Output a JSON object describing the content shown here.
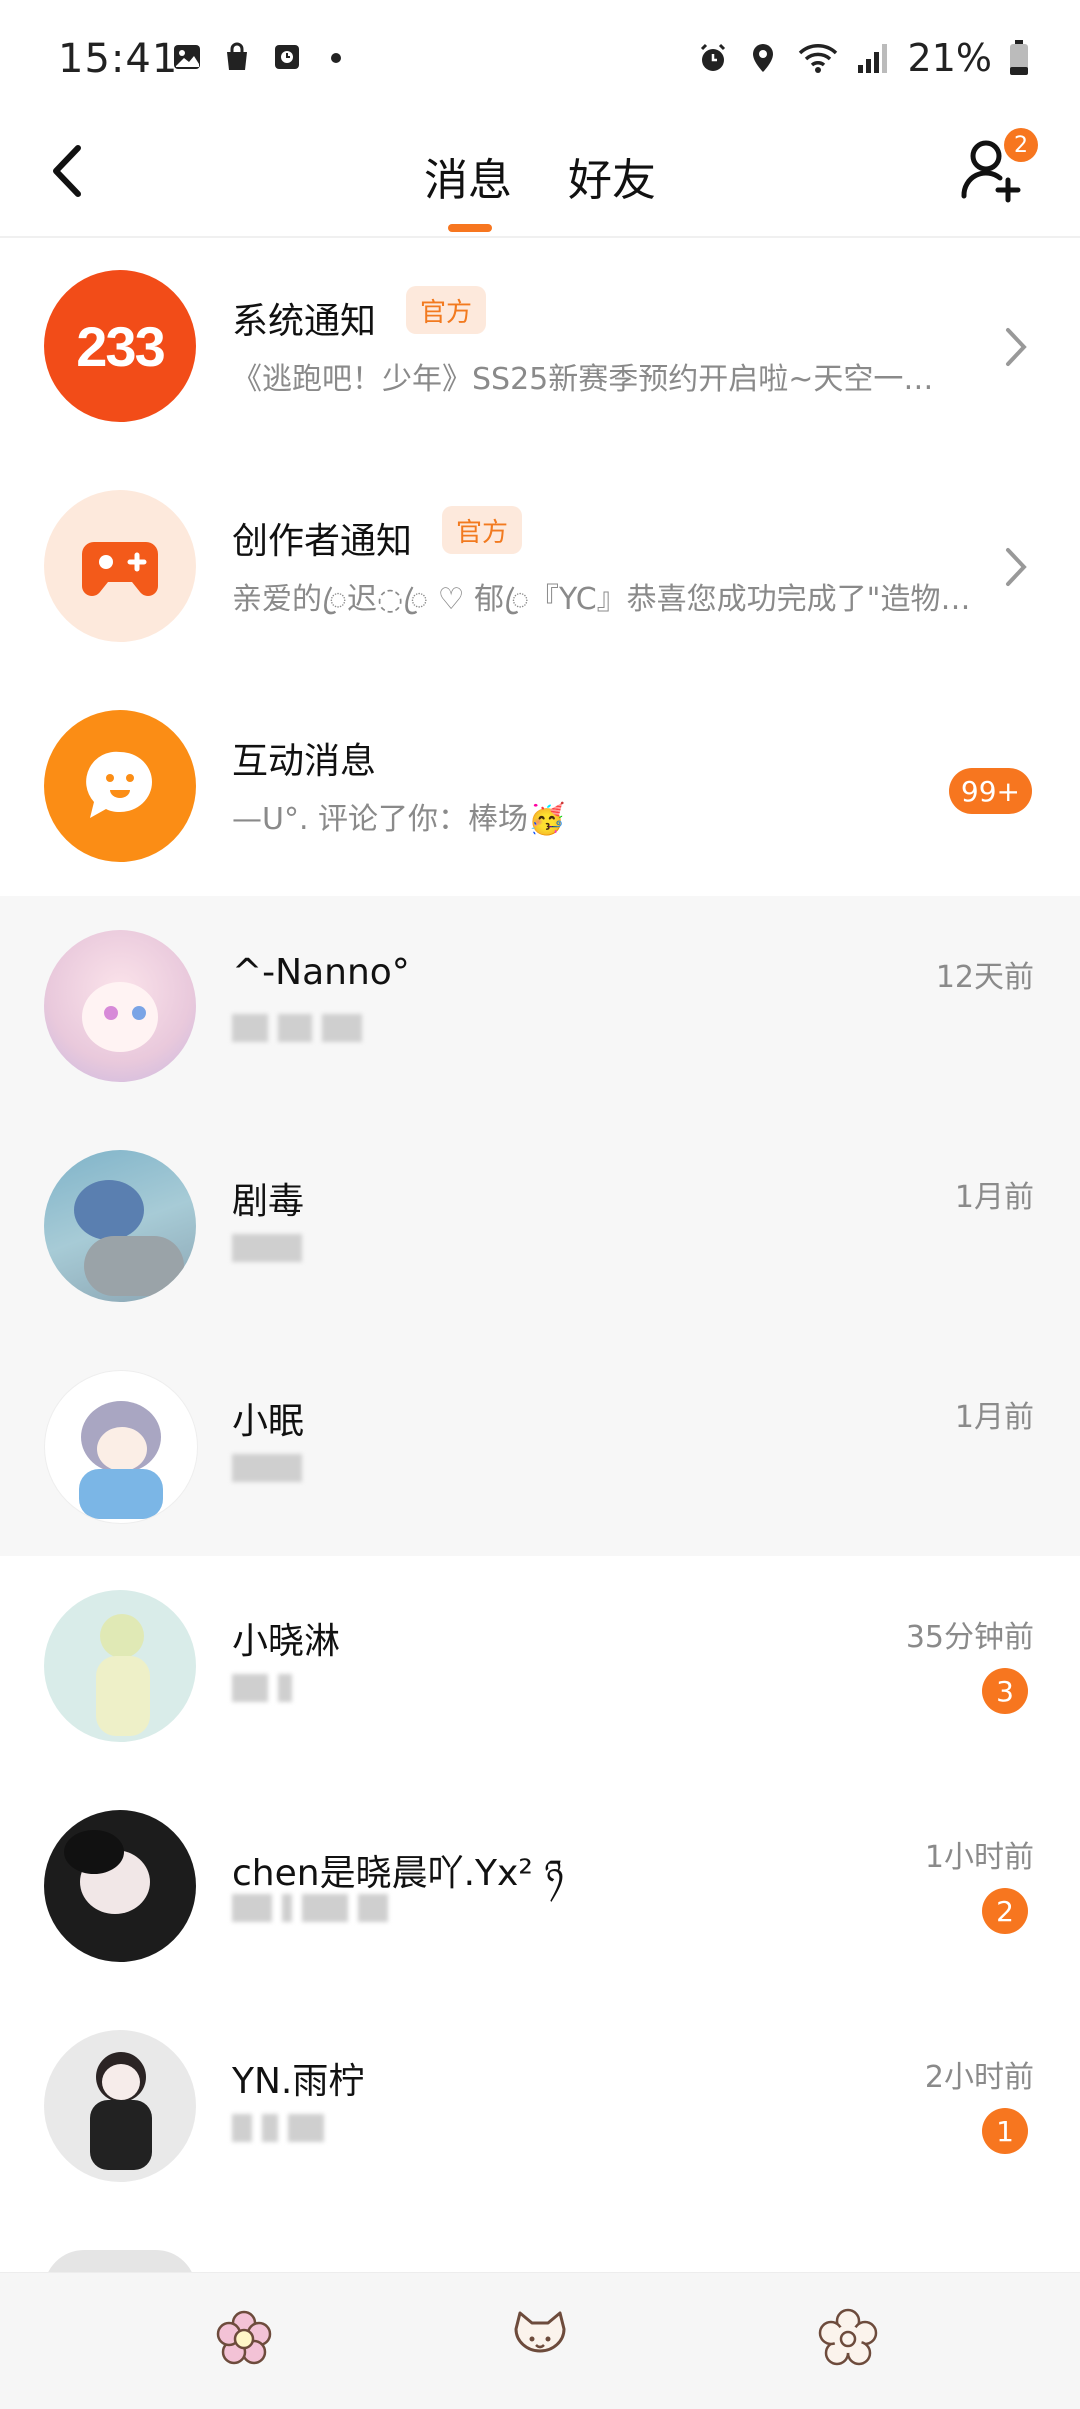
{
  "status_bar": {
    "time": "15:41",
    "battery": "21%"
  },
  "header": {
    "tabs": [
      {
        "label": "消息",
        "active": true
      },
      {
        "label": "好友",
        "active": false
      }
    ],
    "friend_request_badge": "2"
  },
  "notifications": [
    {
      "title": "系统通知",
      "tag": "官方",
      "preview": "《逃跑吧！少年》SS25新赛季预约开启啦~天空一…",
      "avatar_text": "233"
    },
    {
      "title": "创作者通知",
      "tag": "官方",
      "preview": "亲爱的ꦿ迟◌ꦿ ♡ 郁ꦿ『YC』恭喜您成功完成了\"造物…"
    },
    {
      "title": "互动消息",
      "preview": "—ᑌ°. 评论了你：棒场🥳",
      "badge": "99+"
    }
  ],
  "chats": [
    {
      "name": "^-Nanno°",
      "time": "12天前"
    },
    {
      "name": "剧毒",
      "time": "1月前"
    },
    {
      "name": "小眠",
      "time": "1月前"
    },
    {
      "name": "小晓淋",
      "time": "35分钟前",
      "unread": "3"
    },
    {
      "name": "chen是晓晨吖.Yx² ཉ",
      "time": "1小时前",
      "unread": "2"
    },
    {
      "name": "YN.雨柠",
      "time": "2小时前",
      "unread": "1"
    }
  ],
  "colors": {
    "accent": "#f7761f",
    "tag_bg": "#fde9dc",
    "pinned_bg": "#f7f7f7"
  },
  "bottom_nav": {
    "items": [
      "flower-icon",
      "cat-face-icon",
      "settings-flower-icon"
    ]
  }
}
